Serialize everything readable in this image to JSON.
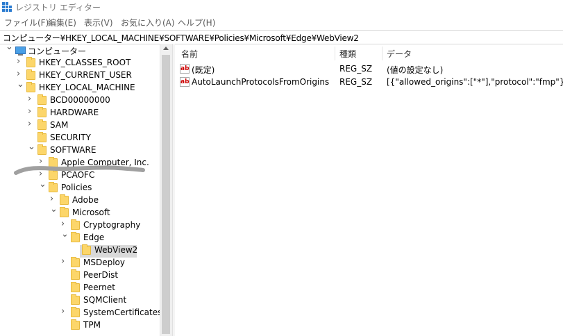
{
  "window": {
    "title": "レジストリ エディター"
  },
  "menu": [
    "ファイル(F)",
    "編集(E)",
    "表示(V)",
    "お気に入り(A)",
    "ヘルプ(H)"
  ],
  "address": "コンピューター¥HKEY_LOCAL_MACHINE¥SOFTWARE¥Policies¥Microsoft¥Edge¥WebView2",
  "tree": [
    {
      "label": "コンピューター",
      "icon": "computer-icon",
      "chevron": "expanded"
    },
    {
      "label": "HKEY_CLASSES_ROOT",
      "chevron": "collapsed"
    },
    {
      "label": "HKEY_CURRENT_USER",
      "chevron": "collapsed"
    },
    {
      "label": "HKEY_LOCAL_MACHINE",
      "chevron": "expanded"
    },
    {
      "label": "BCD00000000",
      "chevron": "collapsed"
    },
    {
      "label": "HARDWARE",
      "chevron": "collapsed"
    },
    {
      "label": "SAM",
      "chevron": "collapsed"
    },
    {
      "label": "SECURITY",
      "chevron": "none"
    },
    {
      "label": "SOFTWARE",
      "chevron": "expanded"
    },
    {
      "label": "Apple Computer, Inc.",
      "chevron": "collapsed"
    },
    {
      "label": "PCAOFC",
      "chevron": "collapsed"
    },
    {
      "label": "Policies",
      "chevron": "expanded"
    },
    {
      "label": "Adobe",
      "chevron": "collapsed"
    },
    {
      "label": "Microsoft",
      "chevron": "expanded"
    },
    {
      "label": "Cryptography",
      "chevron": "collapsed"
    },
    {
      "label": "Edge",
      "chevron": "expanded"
    },
    {
      "label": "WebView2",
      "chevron": "none",
      "selected": true
    },
    {
      "label": "MSDeploy",
      "chevron": "collapsed"
    },
    {
      "label": "PeerDist",
      "chevron": "none"
    },
    {
      "label": "Peernet",
      "chevron": "none"
    },
    {
      "label": "SQMClient",
      "chevron": "none"
    },
    {
      "label": "SystemCertificates",
      "chevron": "collapsed"
    },
    {
      "label": "TPM",
      "chevron": "none"
    }
  ],
  "list": {
    "columns": [
      "名前",
      "種類",
      "データ"
    ],
    "rows": [
      {
        "name": "(既定)",
        "type": "REG_SZ",
        "data": "(値の設定なし)"
      },
      {
        "name": "AutoLaunchProtocolsFromOrigins",
        "type": "REG_SZ",
        "data": "[{\"allowed_origins\":[\"*\"],\"protocol\":\"fmp\"}]"
      }
    ]
  },
  "colors": {
    "folder": "#fcd66a",
    "selection": "#d9d9d9"
  }
}
